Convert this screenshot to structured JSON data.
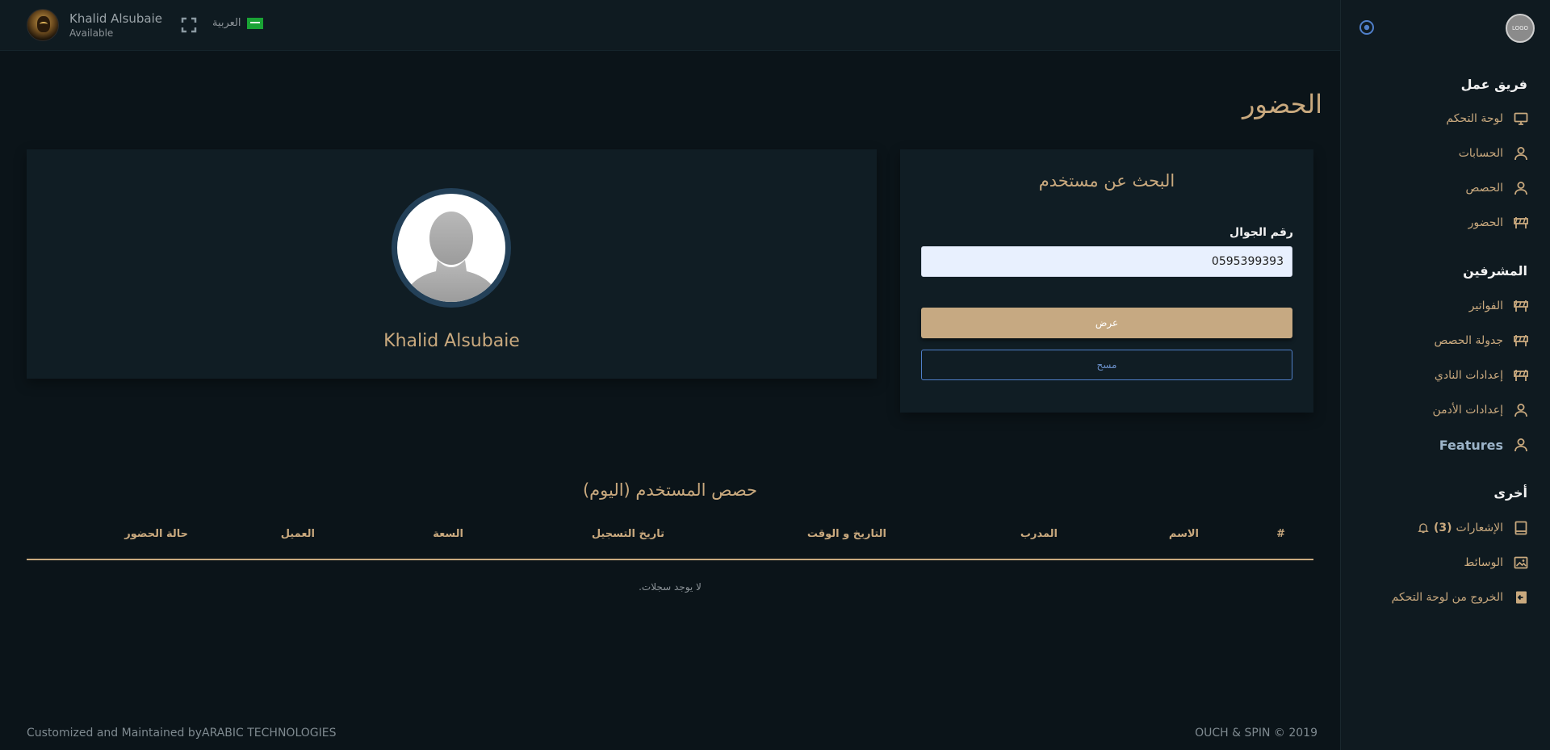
{
  "header": {
    "user_name": "Khalid Alsubaie",
    "user_status": "Available",
    "language": "العربية"
  },
  "sidebar": {
    "logo_text": "LOGO",
    "sections": [
      {
        "title": "فريق عمل"
      },
      {
        "title": "المشرفين"
      },
      {
        "title": "أخرى"
      }
    ],
    "items": [
      {
        "label": "لوحة التحكم",
        "icon": "monitor-icon"
      },
      {
        "label": "الحسابات",
        "icon": "user-icon"
      },
      {
        "label": "الحصص",
        "icon": "user-icon"
      },
      {
        "label": "الحضور",
        "icon": "road-barrier-icon"
      },
      {
        "label": "الفواتير",
        "icon": "road-barrier-icon"
      },
      {
        "label": "جدولة الحصص",
        "icon": "road-barrier-icon"
      },
      {
        "label": "إعدادات النادي",
        "icon": "road-barrier-icon"
      },
      {
        "label": "إعدادات الأدمن",
        "icon": "user-icon"
      },
      {
        "label": "Features",
        "icon": "user-icon"
      },
      {
        "label": "الإشعارات",
        "count": "(3)",
        "icon": "book-icon"
      },
      {
        "label": "الوسائط",
        "icon": "image-icon"
      },
      {
        "label": "الخروج من لوحة التحكم",
        "icon": "logout-icon"
      }
    ]
  },
  "main": {
    "page_title": "الحضور",
    "profile_name": "Khalid Alsubaie",
    "search": {
      "title": "البحث عن مستخدم",
      "phone_label": "رقم الجوال",
      "phone_value": "0595399393",
      "show_label": "عرض",
      "clear_label": "مسح"
    },
    "sessions": {
      "title": "حصص المستخدم (اليوم)",
      "columns": [
        "#",
        "الاسم",
        "المدرب",
        "التاريخ و الوقت",
        "تاريخ التسجيل",
        "السعة",
        "العميل",
        "حالة الحضور"
      ],
      "empty_text": "لا يوجد سجلات."
    }
  },
  "footer": {
    "left": "Customized and Maintained byARABIC TECHNOLOGIES",
    "right": "OUCH & SPIN  © 2019"
  },
  "colors": {
    "background": "#0b1419",
    "card": "#101d24",
    "accent_gold": "#c9a97e",
    "button_gold": "#c6a982",
    "outline_blue": "#4f7fc9"
  }
}
